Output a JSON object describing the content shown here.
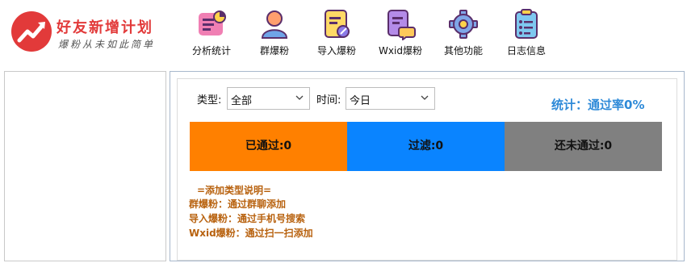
{
  "brand": {
    "title": "好友新增计划",
    "subtitle": "爆粉从未如此简单",
    "accent": "#e23a3a"
  },
  "toolbar": [
    {
      "label": "分析统计",
      "icon": "analytics-chart-icon"
    },
    {
      "label": "群爆粉",
      "icon": "group-user-icon"
    },
    {
      "label": "导入爆粉",
      "icon": "import-document-icon"
    },
    {
      "label": "Wxid爆粉",
      "icon": "wxid-chat-icon"
    },
    {
      "label": "其他功能",
      "icon": "gear-icon"
    },
    {
      "label": "日志信息",
      "icon": "log-clipboard-icon"
    }
  ],
  "filters": {
    "type_label": "类型:",
    "type_value": "全部",
    "time_label": "时间:",
    "time_value": "今日"
  },
  "stat": {
    "text": "统计：通过率0%",
    "color": "#2e8ad8"
  },
  "cards": {
    "passed": "已通过:0",
    "filtered": "过滤:0",
    "pending": "还未通过:0",
    "colors": {
      "passed": "#ff8000",
      "filtered": "#0a84ff",
      "pending": "#808080"
    }
  },
  "description": {
    "heading": "=添加类型说明=",
    "lines": [
      "群爆粉：通过群聊添加",
      "导入爆粉：通过手机号搜索",
      "Wxid爆粉：通过扫一扫添加"
    ],
    "color": "#b8620f"
  }
}
